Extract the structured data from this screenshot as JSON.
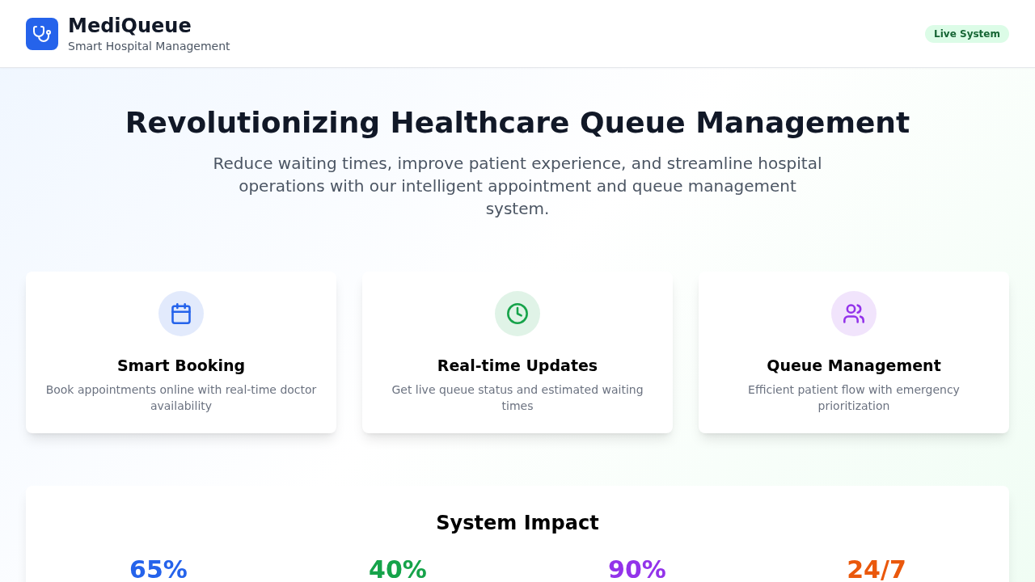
{
  "header": {
    "app_name": "MediQueue",
    "tagline": "Smart Hospital Management",
    "status_badge": "Live System"
  },
  "hero": {
    "title": "Revolutionizing Healthcare Queue Management",
    "description": "Reduce waiting times, improve patient experience, and streamline hospital operations with our intelligent appointment and queue management system."
  },
  "features": [
    {
      "kind": "calendar",
      "color": "#2563eb",
      "title": "Smart Booking",
      "description": "Book appointments online with real-time doctor availability"
    },
    {
      "kind": "clock",
      "color": "#16a34a",
      "title": "Real-time Updates",
      "description": "Get live queue status and estimated waiting times"
    },
    {
      "kind": "users",
      "color": "#9333ea",
      "title": "Queue Management",
      "description": "Efficient patient flow with emergency prioritization"
    }
  ],
  "impact": {
    "title": "System Impact",
    "stats": [
      {
        "value": "65%",
        "color": "#2563eb"
      },
      {
        "value": "40%",
        "color": "#16a34a"
      },
      {
        "value": "90%",
        "color": "#9333ea"
      },
      {
        "value": "24/7",
        "color": "#ea580c"
      }
    ]
  }
}
